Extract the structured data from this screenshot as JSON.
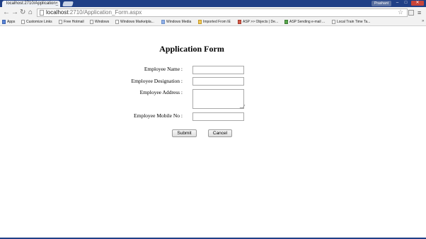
{
  "browser": {
    "tab_title": "localhost:2710/Application_",
    "tab_close": "×",
    "user_badge": "Prashant",
    "url_host": "localhost",
    "url_path": ":2710/Application_Form.aspx",
    "win_minimize": "–",
    "win_maximize": "□",
    "win_close": "✕"
  },
  "bookmarks": [
    {
      "label": "Apps",
      "icon": "apps-grid"
    },
    {
      "label": "Customize Links",
      "icon": "page"
    },
    {
      "label": "Free Hotmail",
      "icon": "page"
    },
    {
      "label": "Windows",
      "icon": "page"
    },
    {
      "label": "Windows Marketpla...",
      "icon": "page"
    },
    {
      "label": "Windows Media",
      "icon": "windows-logo"
    },
    {
      "label": "Imported From IE",
      "icon": "folder"
    },
    {
      "label": "ASP >> Objects | De...",
      "icon": "asp-logo"
    },
    {
      "label": "ASP Sending e-mail ...",
      "icon": "green-logo"
    },
    {
      "label": "Local Train Time Ta...",
      "icon": "page"
    }
  ],
  "form": {
    "title": "Application Form",
    "labels": {
      "name": "Employee Name :",
      "designation": "Employee Designation :",
      "address": "Employee Address :",
      "mobile": "Employee Mobile No :"
    },
    "values": {
      "name": "",
      "designation": "",
      "address": "",
      "mobile": ""
    },
    "submit": "Submit",
    "cancel": "Cancel"
  }
}
